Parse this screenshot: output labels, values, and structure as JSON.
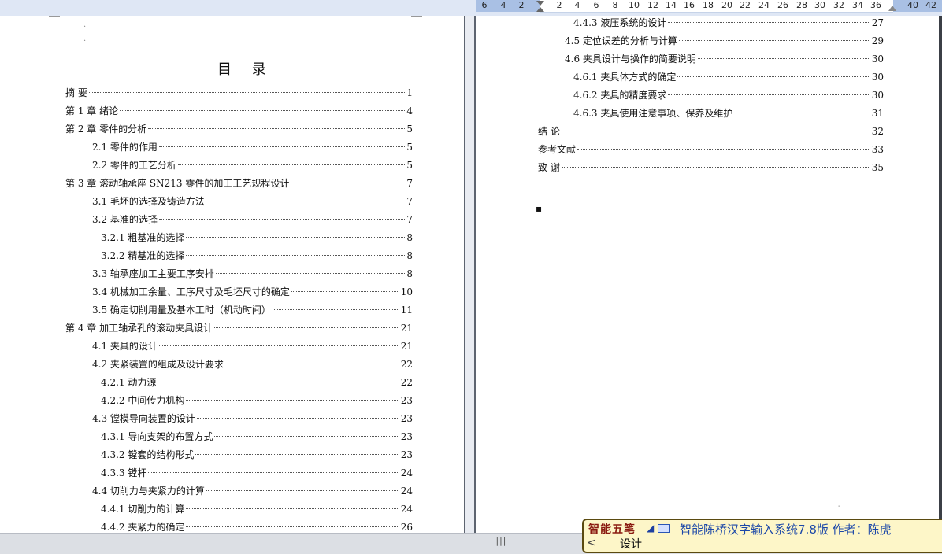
{
  "ruler": {
    "numbers": [
      "6",
      "4",
      "2",
      "2",
      "4",
      "6",
      "8",
      "10",
      "12",
      "14",
      "16",
      "18",
      "20",
      "22",
      "24",
      "26",
      "28",
      "30",
      "32",
      "34",
      "36",
      "40",
      "42"
    ]
  },
  "left_page": {
    "title": "目 录",
    "entries": [
      {
        "text": "摘  要",
        "page": "1"
      },
      {
        "text": "第 1 章  绪论",
        "page": "4"
      },
      {
        "text": "第 2 章  零件的分析",
        "page": "5"
      },
      {
        "text": "2.1  零件的作用",
        "page": "5"
      },
      {
        "text": "2.2  零件的工艺分析",
        "page": "5"
      },
      {
        "text": "第 3 章  滚动轴承座 SN213 零件的加工工艺规程设计",
        "page": "7"
      },
      {
        "text": "3.1 毛坯的选择及铸造方法",
        "page": "7"
      },
      {
        "text": "3.2 基准的选择",
        "page": "7"
      },
      {
        "text": "3.2.1 粗基准的选择",
        "page": "8"
      },
      {
        "text": "3.2.2 精基准的选择",
        "page": "8"
      },
      {
        "text": "3.3  轴承座加工主要工序安排",
        "page": "8"
      },
      {
        "text": "3.4  机械加工余量、工序尺寸及毛坯尺寸的确定",
        "page": "10"
      },
      {
        "text": "3.5 确定切削用量及基本工时（机动时间）",
        "page": "11"
      },
      {
        "text": "第 4 章    加工轴承孔的滚动夹具设计",
        "page": "21"
      },
      {
        "text": "4.1  夹具的设计",
        "page": "21"
      },
      {
        "text": "4.2 夹紧装置的组成及设计要求",
        "page": "22"
      },
      {
        "text": "4.2.1 动力源",
        "page": "22"
      },
      {
        "text": "4.2.2 中间传力机构",
        "page": "23"
      },
      {
        "text": "4.3 镗模导向装置的设计",
        "page": "23"
      },
      {
        "text": "4.3.1 导向支架的布置方式",
        "page": "23"
      },
      {
        "text": "4.3.2 镗套的结构形式",
        "page": "23"
      },
      {
        "text": "4.3.3 镗杆",
        "page": "24"
      },
      {
        "text": "4.4  切削力与夹紧力的计算",
        "page": "24"
      },
      {
        "text": "4.4.1 切削力的计算",
        "page": "24"
      },
      {
        "text": "4.4.2 夹紧力的确定",
        "page": "26"
      }
    ]
  },
  "right_page": {
    "entries": [
      {
        "text": "4.4.3 液压系统的设计",
        "page": "27"
      },
      {
        "text": "4.5 定位误差的分析与计算",
        "page": "29"
      },
      {
        "text": "4.6 夹具设计与操作的简要说明",
        "page": "30"
      },
      {
        "text": "4.6.1 夹具体方式的确定",
        "page": "30"
      },
      {
        "text": "4.6.2 夹具的精度要求",
        "page": "30"
      },
      {
        "text": "4.6.3 夹具使用注意事项、保养及维护",
        "page": "31"
      },
      {
        "text": "结  论",
        "page": "32"
      },
      {
        "text": "参考文献",
        "page": "33"
      },
      {
        "text": "致      谢",
        "page": "35"
      }
    ]
  },
  "status_bar": {
    "grip": "|||"
  },
  "ime": {
    "logo": "智能五笔",
    "title": "智能陈桥汉字输入系统7.8版    作者：陈虎",
    "arrow": "<",
    "input_text": "设计"
  }
}
